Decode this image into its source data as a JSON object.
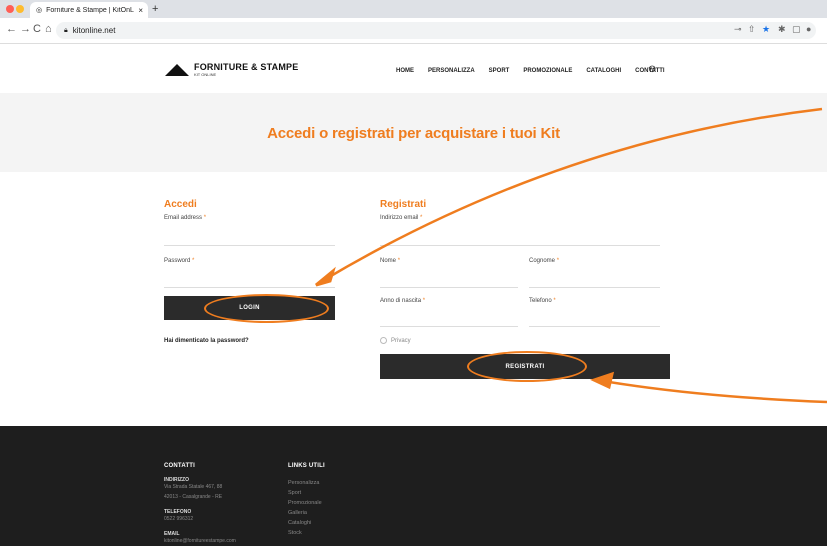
{
  "browser": {
    "tab_title": "Forniture & Stampe | KitOnLine",
    "tab_close": "×",
    "new_tab": "+",
    "url": "kitonline.net",
    "back": "←",
    "forward": "→",
    "reload": "C",
    "home": "⌂"
  },
  "header": {
    "logo_title": "FORNITURE & STAMPE",
    "logo_sub": "KIT ONLINE",
    "menu": [
      "HOME",
      "PERSONALIZZA",
      "SPORT",
      "PROMOZIONALE",
      "CATALOGHI",
      "CONTATTI"
    ]
  },
  "hero": {
    "title": "Accedi o registrati per acquistare i tuoi Kit"
  },
  "login": {
    "title": "Accedi",
    "email_label": "Email address",
    "password_label": "Password",
    "required_mark": "*",
    "button": "LOGIN",
    "forgot": "Hai dimenticato la password?"
  },
  "register": {
    "title": "Registrati",
    "email_label": "Indirizzo email",
    "nome_label": "Nome",
    "cognome_label": "Cognome",
    "anno_label": "Anno di nascita",
    "telefono_label": "Telefono",
    "privacy": "Privacy",
    "button": "REGISTRATI"
  },
  "footer": {
    "contatti_title": "CONTATTI",
    "indirizzo_label": "INDIRIZZO",
    "indirizzo_1": "Via Strada Statale 467, 88",
    "indirizzo_2": "42013 - Casalgrande - RE",
    "telefono_label": "TELEFONO",
    "telefono": "0522 996312",
    "email_label": "EMAIL",
    "email": "kitonline@fornitureestampe.com",
    "links_title": "LINKS UTILI",
    "links": [
      "Personalizza",
      "Sport",
      "Promozionale",
      "Galleria",
      "Cataloghi",
      "Stock"
    ]
  },
  "colors": {
    "accent": "#ef7d1f",
    "dark": "#2b2b2b",
    "footer": "#1e1e1e"
  }
}
